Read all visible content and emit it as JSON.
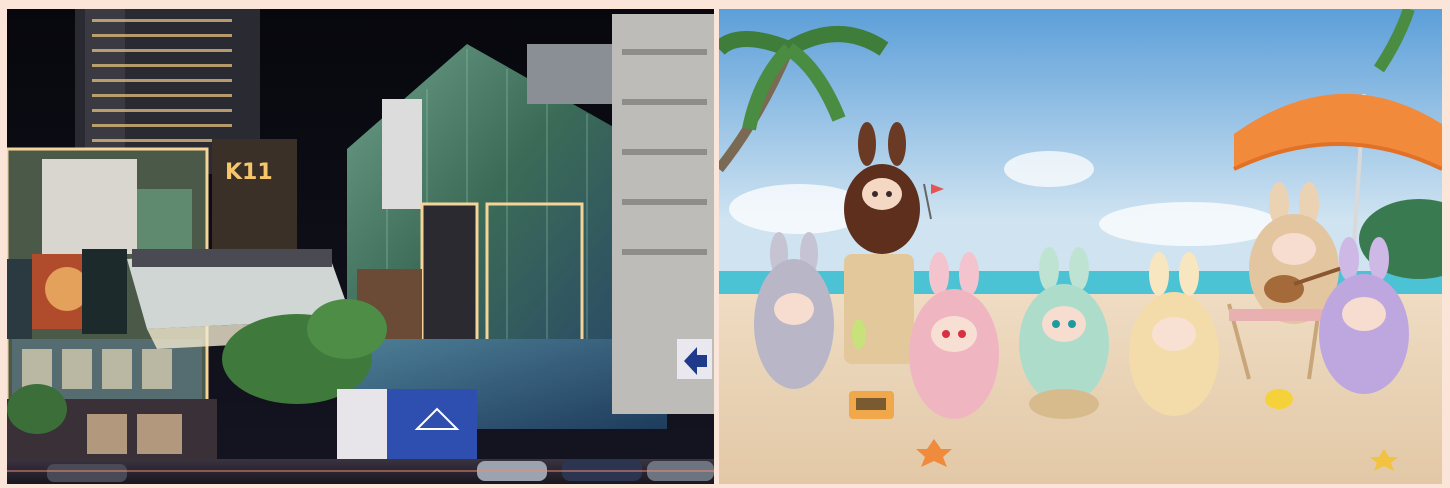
{
  "left_photo": {
    "subject": "night-city-mall",
    "sign_text": "K11",
    "colors": {
      "sky": "#0a0a12",
      "glass": "#3f6f5a",
      "glow": "#f5d49a"
    }
  },
  "right_photo": {
    "subject": "plush-bunny-figures-on-beach",
    "colors": {
      "sky_top": "#6aa9de",
      "sky_bottom": "#cfe3f1",
      "sea": "#49c4d6",
      "sand": "#ead6bd",
      "umbrella": "#f08a3a"
    }
  }
}
